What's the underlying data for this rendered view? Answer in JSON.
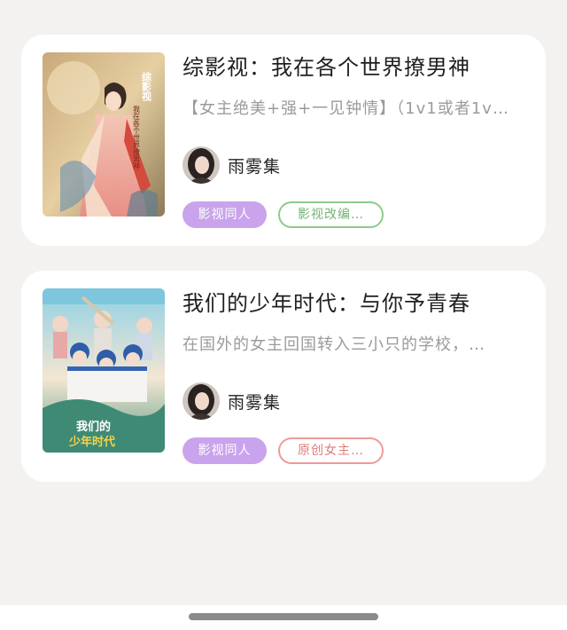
{
  "books": [
    {
      "title": "综影视：我在各个世界撩男神",
      "description": "【女主绝美+强+一见钟情】（1v1或者1v…",
      "author": "雨雾集",
      "tags": [
        "影视同人",
        "影视改编…"
      ],
      "cover_icon": "ancient-costume-heroine-cover",
      "cover_text": [
        "综影视",
        "我在各个世界撩男神"
      ]
    },
    {
      "title": "我们的少年时代：与你予青春",
      "description": "在国外的女主回国转入三小只的学校，…",
      "author": "雨雾集",
      "tags": [
        "影视同人",
        "原创女主…"
      ],
      "cover_icon": "baseball-youth-drama-cover",
      "cover_text": [
        "我们的",
        "少年时代"
      ]
    }
  ],
  "colors": {
    "background": "#f3f2f1",
    "card": "#ffffff",
    "tag_purple": "#c9a3ec",
    "tag_green": "#8ccc8d",
    "tag_red": "#ee9a9a"
  }
}
